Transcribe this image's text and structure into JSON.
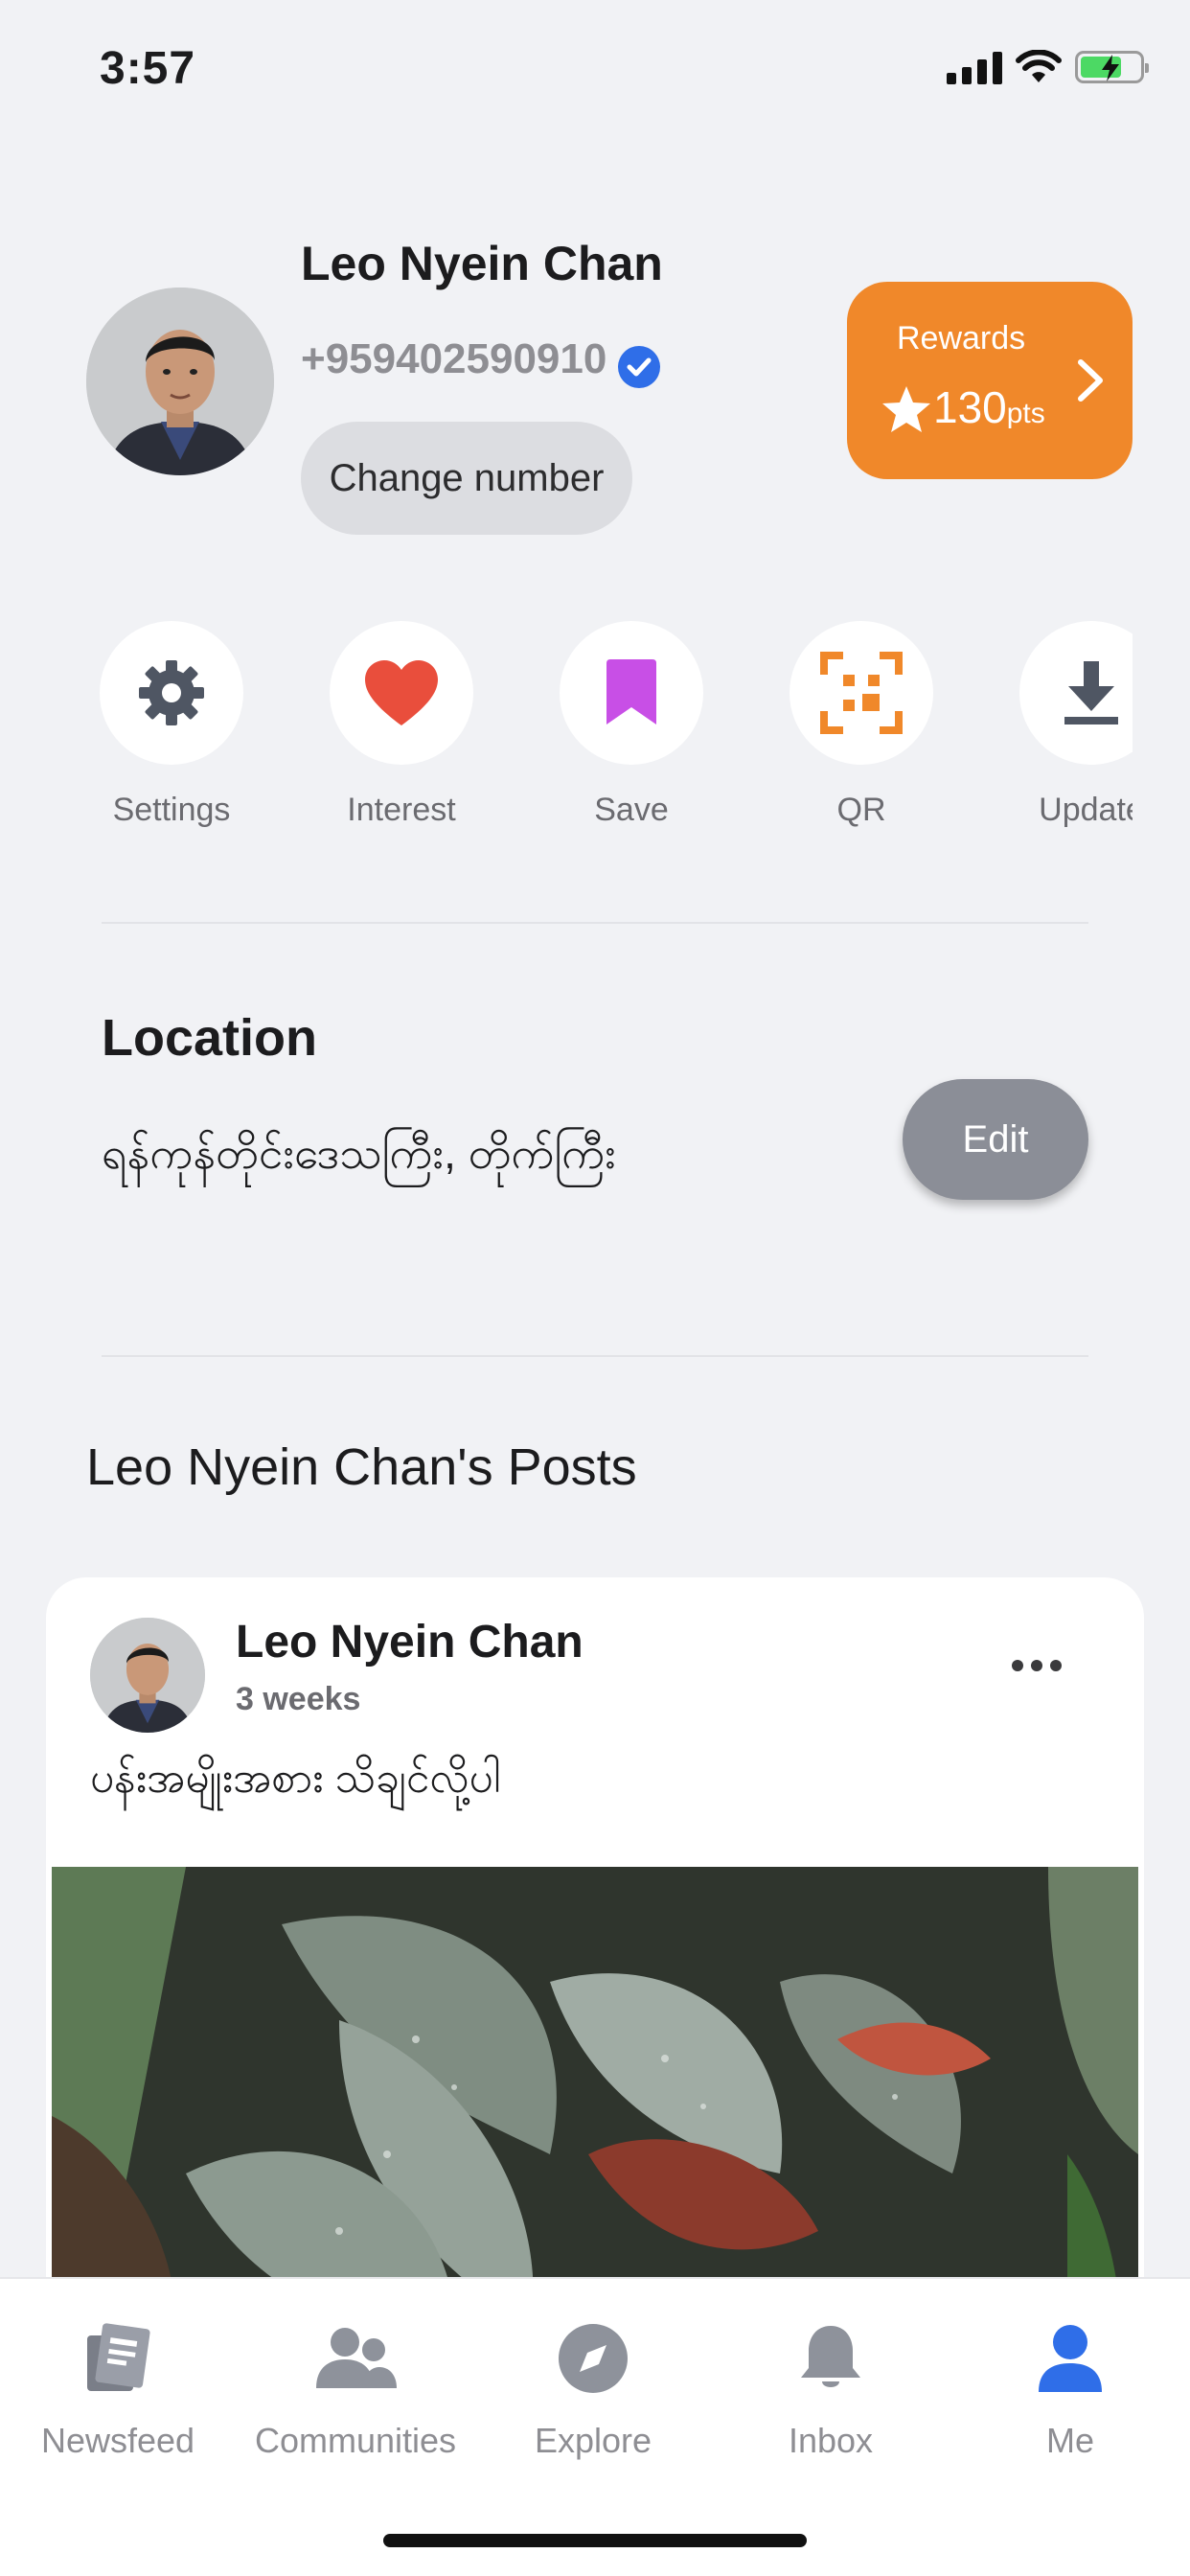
{
  "status_bar": {
    "time": "3:57"
  },
  "profile": {
    "name": "Leo Nyein Chan",
    "phone": "+959402590910",
    "change_number_label": "Change number"
  },
  "rewards": {
    "label": "Rewards",
    "points": "130",
    "unit": "pts"
  },
  "actions": [
    {
      "label": "Settings",
      "icon": "gear-icon"
    },
    {
      "label": "Interest",
      "icon": "heart-icon"
    },
    {
      "label": "Save",
      "icon": "bookmark-icon"
    },
    {
      "label": "QR",
      "icon": "qr-scan-icon"
    },
    {
      "label": "Update",
      "icon": "download-icon"
    }
  ],
  "location": {
    "title": "Location",
    "value": "ရန်ကုန်တိုင်းဒေသကြီး, တိုက်ကြီး",
    "edit_label": "Edit"
  },
  "posts": {
    "section_title": "Leo Nyein Chan's Posts",
    "items": [
      {
        "author": "Leo Nyein Chan",
        "time": "3 weeks",
        "text": "ပန်းအမျိုးအစား သိချင်လို့ပါ"
      }
    ]
  },
  "tab_bar": {
    "tabs": [
      {
        "label": "Newsfeed",
        "icon": "newsfeed-icon"
      },
      {
        "label": "Communities",
        "icon": "communities-icon"
      },
      {
        "label": "Explore",
        "icon": "compass-icon"
      },
      {
        "label": "Inbox",
        "icon": "bell-icon"
      },
      {
        "label": "Me",
        "icon": "person-icon"
      }
    ],
    "active": "Me"
  },
  "colors": {
    "background": "#f1f2f5",
    "rewards": "#f0882a",
    "accent_blue": "#2f6ee8",
    "heart_red": "#e94e3c",
    "bookmark_purple": "#c84fe6",
    "qr_orange": "#f0882a",
    "edit_gray": "#8b8e97"
  }
}
